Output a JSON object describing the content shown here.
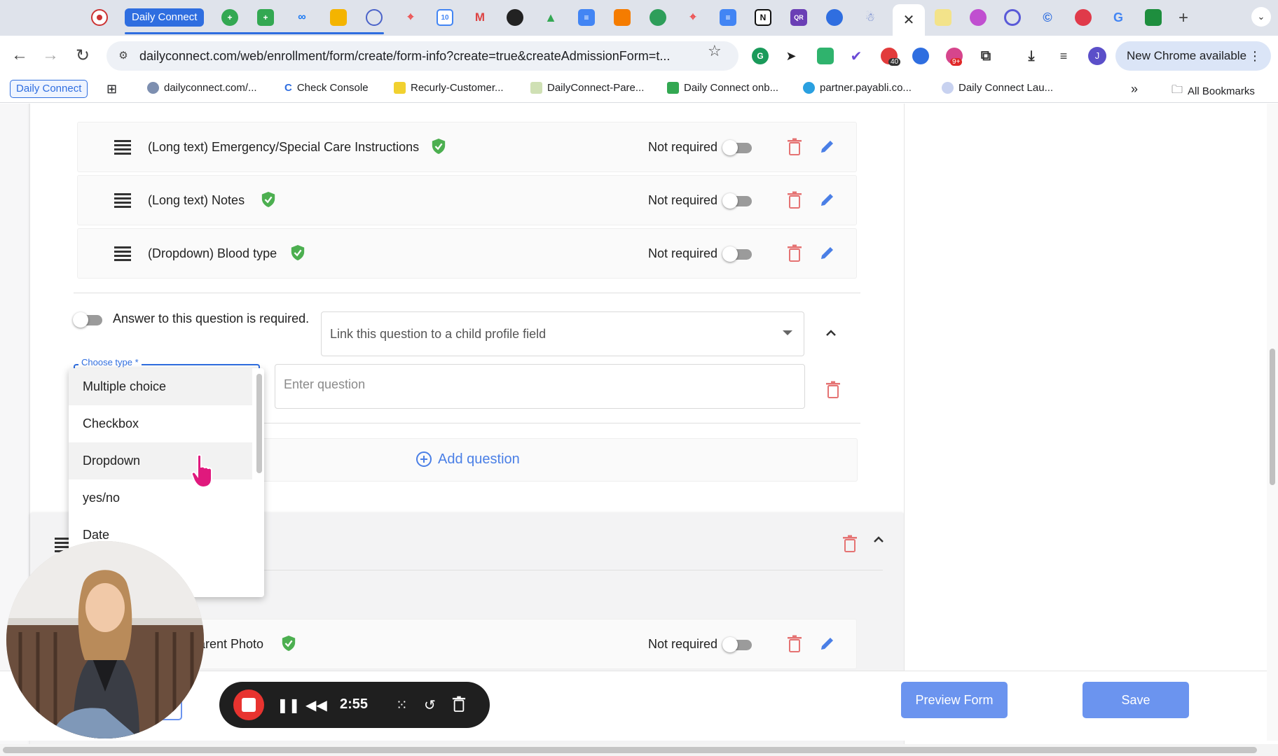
{
  "browser": {
    "pinned_tab_label": "Daily Connect",
    "url": "dailyconnect.com/web/enrollment/form/create/form-info?create=true&createAdmissionForm=t...",
    "new_chrome_label": "New Chrome available",
    "profile_initial": "J",
    "ext_badge_count": "40",
    "ext_badge_count2": "9+",
    "bookmarks": [
      "Daily Connect",
      "dailyconnect.com/...",
      "Check Console",
      "Recurly-Customer...",
      "DailyConnect-Pare...",
      "Daily Connect onb...",
      "partner.payabli.co...",
      "Daily Connect Lau...",
      "All Bookmarks"
    ]
  },
  "questions": [
    {
      "label": "(Long text) Emergency/Special Care Instructions",
      "requirement": "Not required"
    },
    {
      "label": "(Long text) Notes",
      "requirement": "Not required"
    },
    {
      "label": "(Dropdown) Blood type",
      "requirement": "Not required"
    }
  ],
  "new_question": {
    "required_label": "Answer to this question is required.",
    "link_placeholder": "Link this question to a child profile field",
    "type_legend": "Choose type *",
    "question_placeholder": "Enter question",
    "type_options": [
      "Multiple choice",
      "Checkbox",
      "Dropdown",
      "yes/no",
      "Date"
    ],
    "highlighted_option": "Dropdown"
  },
  "add_question_label": "Add question",
  "second_section": {
    "question": {
      "label": "Parent Photo",
      "visible_label": "arent Photo",
      "requirement": "Not required"
    }
  },
  "actions": {
    "preview_label": "Preview Form",
    "save_label": "Save"
  },
  "recorder": {
    "time": "2:55"
  },
  "colors": {
    "accent": "#2f6ee0",
    "button": "#6b94ef",
    "delete": "#e57373",
    "edit": "#4a7fe6",
    "check": "#4caf50",
    "record": "#e8332f"
  }
}
